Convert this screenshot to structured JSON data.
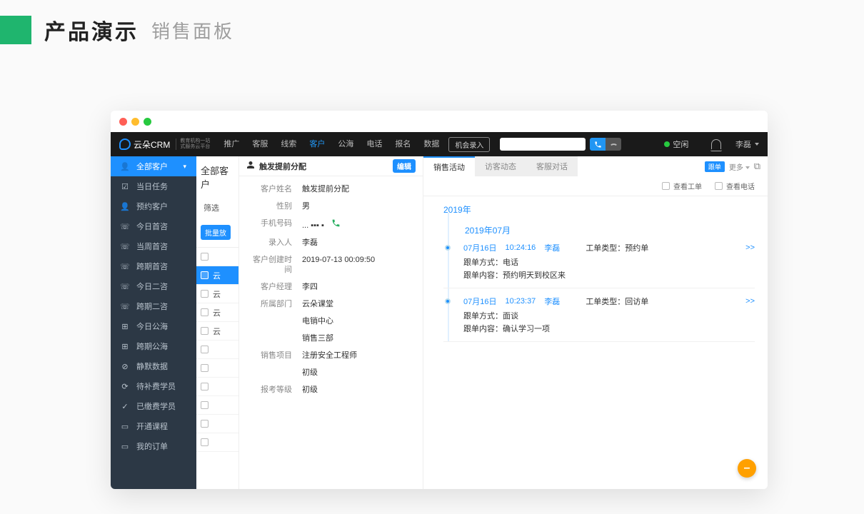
{
  "outer": {
    "title": "产品演示",
    "subtitle": "销售面板"
  },
  "logo": {
    "name": "云朵CRM",
    "sub1": "教育机构一站",
    "sub2": "式服务云平台"
  },
  "nav": {
    "items": [
      "推广",
      "客服",
      "线索",
      "客户",
      "公海",
      "电话",
      "报名",
      "数据"
    ],
    "active_index": 3,
    "pill": "机会录入"
  },
  "status": {
    "text": "空闲"
  },
  "user": {
    "name": "李磊"
  },
  "sidebar": {
    "items": [
      {
        "label": "全部客户",
        "icon": "👤",
        "active": true,
        "chev": true
      },
      {
        "label": "当日任务",
        "icon": "☑"
      },
      {
        "label": "预约客户",
        "icon": "👤"
      },
      {
        "label": "今日首咨",
        "icon": "☏"
      },
      {
        "label": "当周首咨",
        "icon": "☏"
      },
      {
        "label": "跨期首咨",
        "icon": "☏"
      },
      {
        "label": "今日二咨",
        "icon": "☏"
      },
      {
        "label": "跨期二咨",
        "icon": "☏"
      },
      {
        "label": "今日公海",
        "icon": "⊞"
      },
      {
        "label": "跨期公海",
        "icon": "⊞"
      },
      {
        "label": "静默数据",
        "icon": "⊘"
      },
      {
        "label": "待补费学员",
        "icon": "⟳"
      },
      {
        "label": "已缴费学员",
        "icon": "✓"
      },
      {
        "label": "开通课程",
        "icon": "▭"
      },
      {
        "label": "我的订单",
        "icon": "▭"
      }
    ]
  },
  "mid": {
    "header": "全部客户",
    "filter_label": "筛选",
    "batch_btn": "批量放",
    "rows": [
      "",
      "云",
      "云",
      "云",
      "云",
      "",
      "",
      "",
      "",
      "",
      ""
    ]
  },
  "detail": {
    "title": "触发提前分配",
    "edit_btn": "编辑",
    "phone_masked": "... ▪▪▪ ▪",
    "fields": [
      {
        "label": "客户姓名",
        "value": "触发提前分配"
      },
      {
        "label": "性别",
        "value": "男"
      },
      {
        "label": "手机号码",
        "value": "",
        "phone": true
      },
      {
        "label": "录入人",
        "value": "李磊"
      },
      {
        "label": "客户创建时间",
        "value": "2019-07-13 00:09:50"
      },
      {
        "label": "客户经理",
        "value": "李四"
      },
      {
        "label": "所属部门",
        "value": "云朵课堂"
      },
      {
        "label": "",
        "value": "电销中心"
      },
      {
        "label": "",
        "value": "销售三部"
      },
      {
        "label": "销售项目",
        "value": "注册安全工程师"
      },
      {
        "label": "",
        "value": "初级"
      },
      {
        "label": "报考等级",
        "value": "初级"
      }
    ]
  },
  "activity": {
    "tabs": [
      "销售活动",
      "访客动态",
      "客服对话"
    ],
    "active_tab": 0,
    "tag": "跟单",
    "more": "更多",
    "filter_ticket": "查看工单",
    "filter_phone": "查看电话",
    "year": "2019年",
    "month": "2019年07月",
    "items": [
      {
        "date": "07月16日",
        "time": "10:24:16",
        "user": "李磊",
        "type_label": "工单类型：",
        "type_value": "预约单",
        "method_label": "跟单方式：",
        "method_value": "电话",
        "content_label": "跟单内容：",
        "content_value": "预约明天到校区来",
        "more": ">>"
      },
      {
        "date": "07月16日",
        "time": "10:23:37",
        "user": "李磊",
        "type_label": "工单类型：",
        "type_value": "回访单",
        "method_label": "跟单方式：",
        "method_value": "面谈",
        "content_label": "跟单内容：",
        "content_value": "确认学习一项",
        "more": ">>"
      }
    ]
  }
}
